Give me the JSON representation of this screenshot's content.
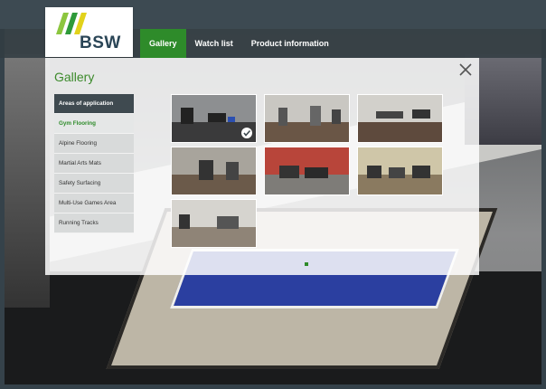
{
  "brand": {
    "logo_text": "BSW"
  },
  "nav": {
    "items": [
      {
        "label": "Gallery",
        "active": true
      },
      {
        "label": "Watch list",
        "active": false
      },
      {
        "label": "Product information",
        "active": false
      }
    ]
  },
  "gallery": {
    "title": "Gallery",
    "close_icon": "close-icon",
    "sidebar": {
      "header": "Areas of application",
      "items": [
        {
          "label": "Gym Flooring",
          "active": true
        },
        {
          "label": "Alpine Flooring",
          "active": false
        },
        {
          "label": "Martial Arts Mats",
          "active": false
        },
        {
          "label": "Safety Surfacing",
          "active": false
        },
        {
          "label": "Multi-Use Games Area",
          "active": false
        },
        {
          "label": "Running Tracks",
          "active": false
        }
      ]
    },
    "thumbnails": [
      {
        "name": "gym-floor-photo-1",
        "selected": true,
        "floor": "#3a3a3b",
        "ceiling": "#8d8f91"
      },
      {
        "name": "gym-floor-photo-2",
        "selected": false,
        "floor": "#6a5646",
        "ceiling": "#c9c7c2"
      },
      {
        "name": "gym-floor-photo-3",
        "selected": false,
        "floor": "#5e4a3d",
        "ceiling": "#d2d0cb"
      },
      {
        "name": "gym-floor-photo-4",
        "selected": false,
        "floor": "#6b5a4a",
        "ceiling": "#a8a49c"
      },
      {
        "name": "gym-floor-photo-5",
        "selected": false,
        "floor": "#7e7c78",
        "ceiling": "#b8453a"
      },
      {
        "name": "gym-floor-photo-6",
        "selected": false,
        "floor": "#8a7a60",
        "ceiling": "#cfc6a8"
      },
      {
        "name": "gym-floor-photo-7",
        "selected": false,
        "floor": "#8f8477",
        "ceiling": "#d6d4cf"
      }
    ],
    "pagination_color": "#2e8b2a"
  }
}
